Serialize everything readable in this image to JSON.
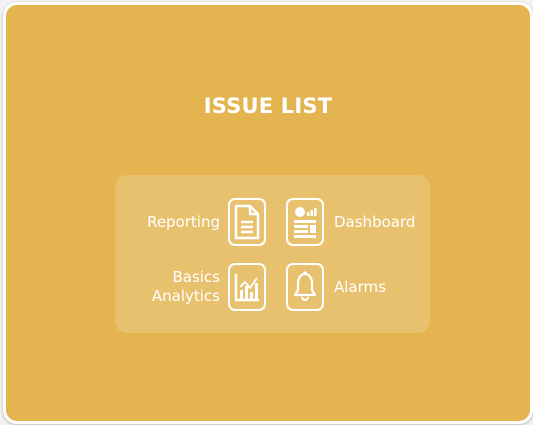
{
  "card": {
    "title": "ISSUE LIST"
  },
  "features": {
    "reporting": {
      "label": "Reporting",
      "icon": "document-icon"
    },
    "dashboard": {
      "label": "Dashboard",
      "icon": "dashboard-icon"
    },
    "analytics": {
      "label_line1": "Basics",
      "label_line2": "Analytics",
      "icon": "bar-chart-icon"
    },
    "alarms": {
      "label": "Alarms",
      "icon": "bell-icon"
    }
  },
  "colors": {
    "card_background": "#e3b44f",
    "text": "#ffffff",
    "border": "#ffffff"
  }
}
